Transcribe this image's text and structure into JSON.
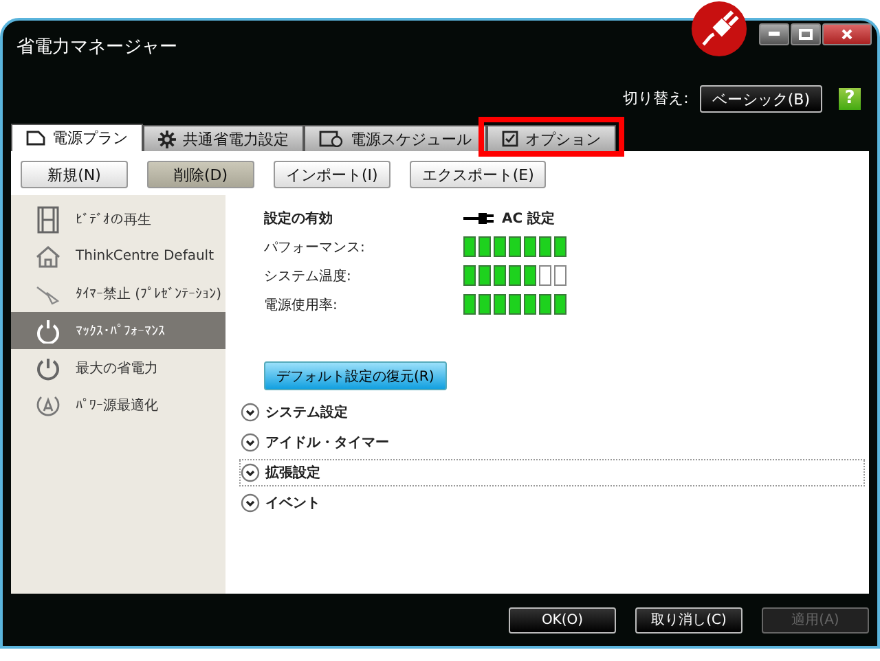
{
  "window": {
    "title": "省電力マネージャー"
  },
  "header": {
    "switch_label": "切り替え:",
    "mode_button": "ベーシック(B)",
    "help": "?"
  },
  "tabs": [
    {
      "label": "電源プラン",
      "selected": true,
      "highlighted": false
    },
    {
      "label": "共通省電力設定",
      "selected": false,
      "highlighted": false
    },
    {
      "label": "電源スケジュール",
      "selected": false,
      "highlighted": false
    },
    {
      "label": "オプション",
      "selected": false,
      "highlighted": true
    }
  ],
  "toolbar": [
    {
      "label": "新規(N)",
      "pressed": false
    },
    {
      "label": "削除(D)",
      "pressed": true
    },
    {
      "label": "インポート(I)",
      "pressed": false
    },
    {
      "label": "エクスポート(E)",
      "pressed": false
    }
  ],
  "sidebar": {
    "items": [
      {
        "label": "ﾋﾞﾃﾞｵの再生",
        "selected": false
      },
      {
        "label": "ThinkCentre Default",
        "selected": false
      },
      {
        "label": "ﾀｲﾏｰ禁止 (ﾌﾟﾚｾﾞﾝﾃｰｼｮﾝ)",
        "selected": false
      },
      {
        "label": "ﾏｯｸｽ･ﾊﾟﾌｫｰﾏﾝｽ",
        "selected": true
      },
      {
        "label": "最大の省電力",
        "selected": false
      },
      {
        "label": "ﾊﾟﾜｰ源最適化",
        "selected": false
      }
    ]
  },
  "settings": {
    "heading": "設定の有効",
    "power_source": "AC 設定",
    "meters": [
      {
        "label": "パフォーマンス:",
        "level": 1
      },
      {
        "label": "システム温度:",
        "level": 0.714
      },
      {
        "label": "電源使用率:",
        "level": 1
      }
    ],
    "restore_button": "デフォルト設定の復元(R)",
    "sections": [
      {
        "label": "システム設定",
        "expanded": false,
        "focused": false
      },
      {
        "label": "アイドル・タイマー",
        "expanded": false,
        "focused": false
      },
      {
        "label": "拡張設定",
        "expanded": false,
        "focused": true
      },
      {
        "label": "イベント",
        "expanded": false,
        "focused": false
      }
    ]
  },
  "buttons": [
    {
      "label": "OK(O)",
      "disabled": false
    },
    {
      "label": "取り消し(C)",
      "disabled": false
    },
    {
      "label": "適用(A)",
      "disabled": true
    }
  ]
}
